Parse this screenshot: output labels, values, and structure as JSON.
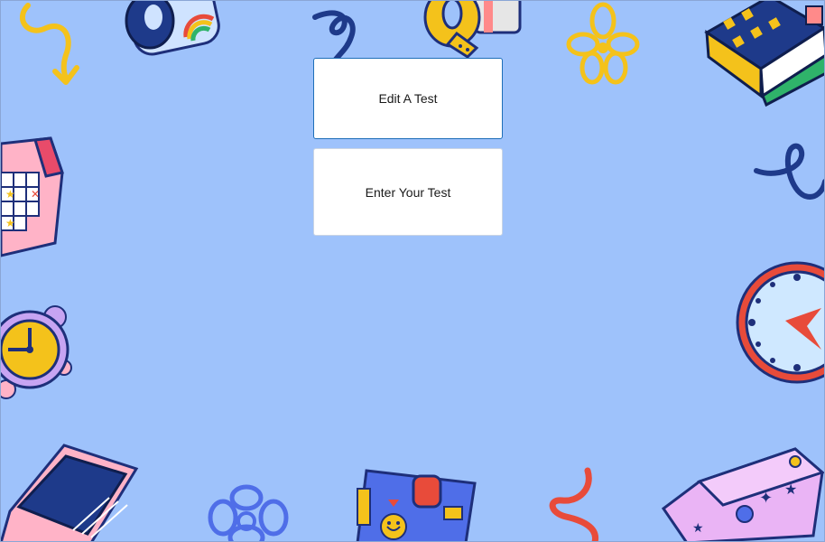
{
  "buttons": {
    "edit_test": "Edit A Test",
    "enter_test": "Enter Your Test"
  },
  "icons": [
    "squiggle-arrow-icon",
    "lens-camera-icon",
    "spiral-icon",
    "tape-roll-icon",
    "flower-outline-icon",
    "books-stack-icon",
    "calendar-icon",
    "swirl-icon",
    "alarm-clock-icon",
    "wall-clock-icon",
    "laptop-icon",
    "flower-outline-blue-icon",
    "planner-notebook-icon",
    "spring-coil-icon",
    "pencil-case-icon"
  ],
  "colors": {
    "background": "#9ec2fb",
    "button_bg": "#ffffff",
    "focus_border": "#1f6fb8"
  }
}
